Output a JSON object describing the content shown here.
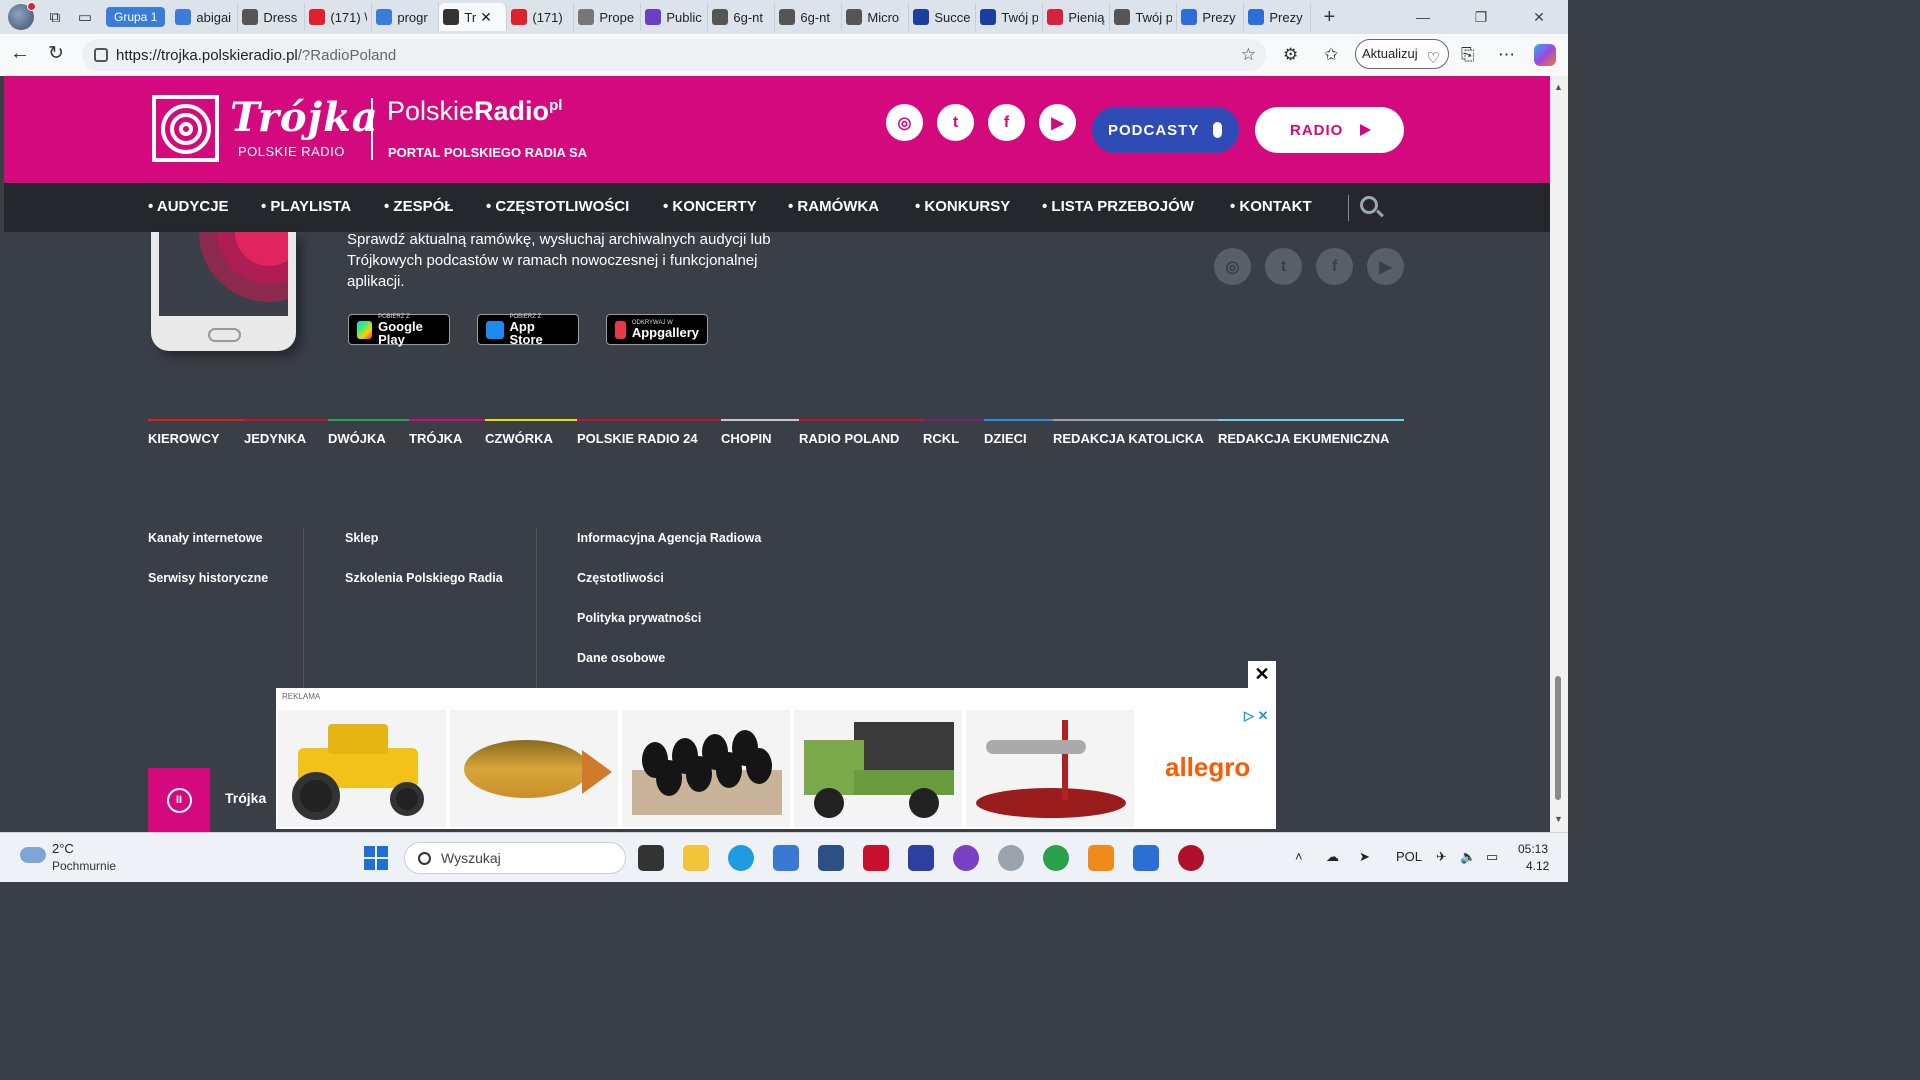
{
  "browser": {
    "group_label": "Grupa 1",
    "tabs": [
      {
        "label": "abigai",
        "icon": "search-icon",
        "color": "#3b7cd8"
      },
      {
        "label": "Dress",
        "icon": "m-icon",
        "color": "#555555"
      },
      {
        "label": "(171) \\",
        "icon": "youtube-icon",
        "color": "#e0202a"
      },
      {
        "label": "progr",
        "icon": "search-icon",
        "color": "#3b7cd8"
      },
      {
        "label": "Tr",
        "icon": "speaker-icon",
        "color": "#333333",
        "active": true
      },
      {
        "label": "(171)",
        "icon": "youtube-icon",
        "color": "#e0202a"
      },
      {
        "label": "Prope",
        "icon": "image-icon",
        "color": "#777777"
      },
      {
        "label": "Public",
        "icon": "spiral-icon",
        "color": "#6b3fc4"
      },
      {
        "label": "6g-nt",
        "icon": "globe-icon",
        "color": "#555555"
      },
      {
        "label": "6g-nt",
        "icon": "globe-icon",
        "color": "#555555"
      },
      {
        "label": "Micro",
        "icon": "globe-icon",
        "color": "#555555"
      },
      {
        "label": "Succe",
        "icon": "eu-icon",
        "color": "#1a3fa0"
      },
      {
        "label": "Twój p",
        "icon": "eu-icon",
        "color": "#1a3fa0"
      },
      {
        "label": "Pienią",
        "icon": "pdf-icon",
        "color": "#d6223a"
      },
      {
        "label": "Twój p",
        "icon": "globe-icon",
        "color": "#555555"
      },
      {
        "label": "Prezy",
        "icon": "doc-icon",
        "color": "#2a6fd6"
      },
      {
        "label": "Prezy",
        "icon": "doc-icon",
        "color": "#2a6fd6"
      }
    ],
    "url_host": "https://trojka.polskieradio.pl",
    "url_path": "/?RadioPoland",
    "update_label": "Aktualizuj"
  },
  "header": {
    "brand": "Trójka",
    "brand_sub": "POLSKIE RADIO",
    "pr_logo_light": "Polskie",
    "pr_logo_bold": "Radio",
    "pr_logo_sup": "pl",
    "portal": "PORTAL POLSKIEGO RADIA SA",
    "podcasts_label": "PODCASTY",
    "radio_label": "RADIO",
    "brand_color": "#d3097d"
  },
  "nav": {
    "items": [
      "AUDYCJE",
      "PLAYLISTA",
      "ZESPÓŁ",
      "CZĘSTOTLIWOŚCI",
      "KONCERTY",
      "RAMÓWKA",
      "KONKURSY",
      "LISTA PRZEBOJÓW",
      "KONTAKT"
    ]
  },
  "app_promo": {
    "text": "Sprawdź aktualną ramówkę, wysłuchaj archiwalnych audycji lub Trójkowych podcastów w ramach nowoczesnej i funkcjonalnej aplikacji.",
    "stores": [
      {
        "small": "POBIERZ Z",
        "name": "Google Play"
      },
      {
        "small": "POBIERZ Z",
        "name": "App Store"
      },
      {
        "small": "ODKRYWAJ W",
        "name": "Appgallery"
      }
    ]
  },
  "stations": [
    "KIEROWCY",
    "JEDYNKA",
    "DWÓJKA",
    "TRÓJKA",
    "CZWÓRKA",
    "POLSKIE RADIO 24",
    "CHOPIN",
    "RADIO POLAND",
    "RCKL",
    "DZIECI",
    "REDAKCJA KATOLICKA",
    "REDAKCJA EKUMENICZNA"
  ],
  "footer": {
    "col1": [
      "Kanały internetowe",
      "Serwisy historyczne"
    ],
    "col2": [
      "Sklep",
      "Szkolenia Polskiego Radia"
    ],
    "col3": [
      "Informacyjna Agencja Radiowa",
      "Częstotliwości",
      "Polityka prywatności",
      "Dane osobowe"
    ]
  },
  "player": {
    "station": "Trójka"
  },
  "ad": {
    "label": "REKLAMA",
    "brand": "allegro",
    "close": "✕"
  },
  "taskbar": {
    "temp": "2°C",
    "weather": "Pochmurnie",
    "search_placeholder": "Wyszukaj",
    "lang": "POL",
    "time": "05:13",
    "date": "4.12"
  }
}
